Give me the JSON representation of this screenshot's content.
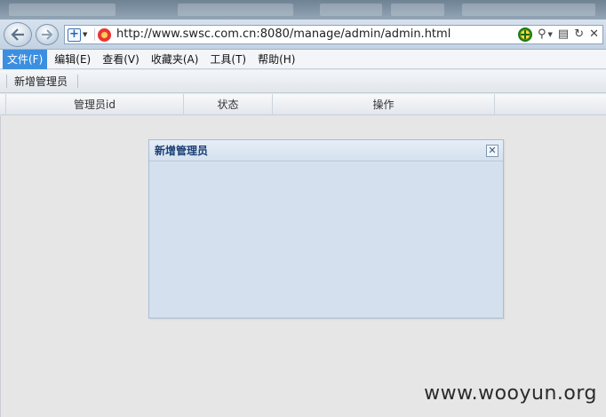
{
  "browser": {
    "address_url": "http://www.swsc.com.cn:8080/manage/admin/admin.html"
  },
  "menu": {
    "items": [
      {
        "label": "文件(F)",
        "active": true
      },
      {
        "label": "编辑(E)",
        "active": false
      },
      {
        "label": "查看(V)",
        "active": false
      },
      {
        "label": "收藏夹(A)",
        "active": false
      },
      {
        "label": "工具(T)",
        "active": false
      },
      {
        "label": "帮助(H)",
        "active": false
      }
    ]
  },
  "toolbar": {
    "add_admin_label": "新增管理员"
  },
  "grid": {
    "columns": [
      "管理员id",
      "状态",
      "操作"
    ]
  },
  "dialog": {
    "title": "新增管理员",
    "close_glyph": "✕"
  },
  "watermark": {
    "text": "www.wooyun.org"
  },
  "icons": {
    "back": "back-arrow-icon",
    "forward": "forward-arrow-icon",
    "shield": "security-shield-icon",
    "site": "site-favicon-icon",
    "add_favorite": "add-favorite-icon",
    "search": "search-icon",
    "compat": "compatibility-view-icon",
    "refresh": "refresh-icon",
    "stop": "stop-icon",
    "close": "close-icon"
  },
  "colors": {
    "menu_active_bg": "#3c8fe0",
    "dialog_title": "#1b3f73",
    "dialog_bg": "#d4e0ee"
  }
}
